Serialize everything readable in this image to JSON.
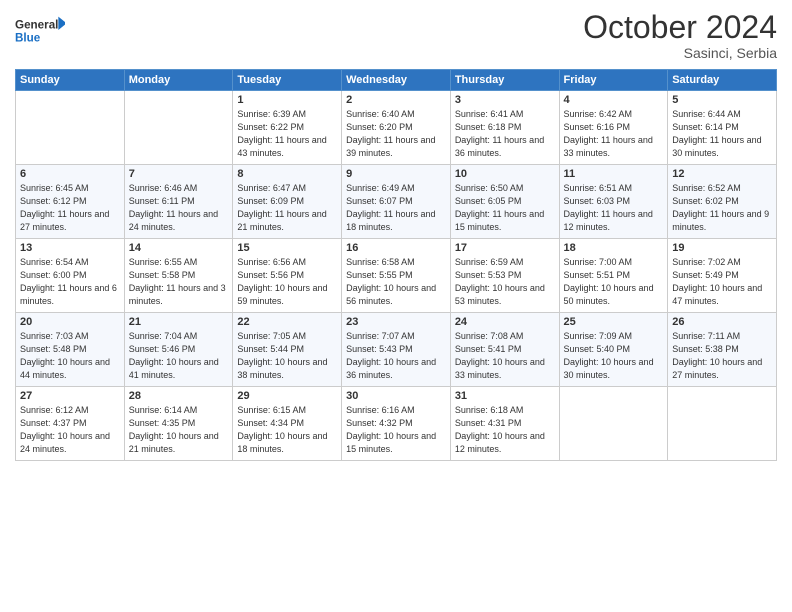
{
  "logo": {
    "line1": "General",
    "line2": "Blue"
  },
  "title": "October 2024",
  "subtitle": "Sasinci, Serbia",
  "days_header": [
    "Sunday",
    "Monday",
    "Tuesday",
    "Wednesday",
    "Thursday",
    "Friday",
    "Saturday"
  ],
  "weeks": [
    [
      {
        "day": "",
        "sunrise": "",
        "sunset": "",
        "daylight": ""
      },
      {
        "day": "",
        "sunrise": "",
        "sunset": "",
        "daylight": ""
      },
      {
        "day": "1",
        "sunrise": "Sunrise: 6:39 AM",
        "sunset": "Sunset: 6:22 PM",
        "daylight": "Daylight: 11 hours and 43 minutes."
      },
      {
        "day": "2",
        "sunrise": "Sunrise: 6:40 AM",
        "sunset": "Sunset: 6:20 PM",
        "daylight": "Daylight: 11 hours and 39 minutes."
      },
      {
        "day": "3",
        "sunrise": "Sunrise: 6:41 AM",
        "sunset": "Sunset: 6:18 PM",
        "daylight": "Daylight: 11 hours and 36 minutes."
      },
      {
        "day": "4",
        "sunrise": "Sunrise: 6:42 AM",
        "sunset": "Sunset: 6:16 PM",
        "daylight": "Daylight: 11 hours and 33 minutes."
      },
      {
        "day": "5",
        "sunrise": "Sunrise: 6:44 AM",
        "sunset": "Sunset: 6:14 PM",
        "daylight": "Daylight: 11 hours and 30 minutes."
      }
    ],
    [
      {
        "day": "6",
        "sunrise": "Sunrise: 6:45 AM",
        "sunset": "Sunset: 6:12 PM",
        "daylight": "Daylight: 11 hours and 27 minutes."
      },
      {
        "day": "7",
        "sunrise": "Sunrise: 6:46 AM",
        "sunset": "Sunset: 6:11 PM",
        "daylight": "Daylight: 11 hours and 24 minutes."
      },
      {
        "day": "8",
        "sunrise": "Sunrise: 6:47 AM",
        "sunset": "Sunset: 6:09 PM",
        "daylight": "Daylight: 11 hours and 21 minutes."
      },
      {
        "day": "9",
        "sunrise": "Sunrise: 6:49 AM",
        "sunset": "Sunset: 6:07 PM",
        "daylight": "Daylight: 11 hours and 18 minutes."
      },
      {
        "day": "10",
        "sunrise": "Sunrise: 6:50 AM",
        "sunset": "Sunset: 6:05 PM",
        "daylight": "Daylight: 11 hours and 15 minutes."
      },
      {
        "day": "11",
        "sunrise": "Sunrise: 6:51 AM",
        "sunset": "Sunset: 6:03 PM",
        "daylight": "Daylight: 11 hours and 12 minutes."
      },
      {
        "day": "12",
        "sunrise": "Sunrise: 6:52 AM",
        "sunset": "Sunset: 6:02 PM",
        "daylight": "Daylight: 11 hours and 9 minutes."
      }
    ],
    [
      {
        "day": "13",
        "sunrise": "Sunrise: 6:54 AM",
        "sunset": "Sunset: 6:00 PM",
        "daylight": "Daylight: 11 hours and 6 minutes."
      },
      {
        "day": "14",
        "sunrise": "Sunrise: 6:55 AM",
        "sunset": "Sunset: 5:58 PM",
        "daylight": "Daylight: 11 hours and 3 minutes."
      },
      {
        "day": "15",
        "sunrise": "Sunrise: 6:56 AM",
        "sunset": "Sunset: 5:56 PM",
        "daylight": "Daylight: 10 hours and 59 minutes."
      },
      {
        "day": "16",
        "sunrise": "Sunrise: 6:58 AM",
        "sunset": "Sunset: 5:55 PM",
        "daylight": "Daylight: 10 hours and 56 minutes."
      },
      {
        "day": "17",
        "sunrise": "Sunrise: 6:59 AM",
        "sunset": "Sunset: 5:53 PM",
        "daylight": "Daylight: 10 hours and 53 minutes."
      },
      {
        "day": "18",
        "sunrise": "Sunrise: 7:00 AM",
        "sunset": "Sunset: 5:51 PM",
        "daylight": "Daylight: 10 hours and 50 minutes."
      },
      {
        "day": "19",
        "sunrise": "Sunrise: 7:02 AM",
        "sunset": "Sunset: 5:49 PM",
        "daylight": "Daylight: 10 hours and 47 minutes."
      }
    ],
    [
      {
        "day": "20",
        "sunrise": "Sunrise: 7:03 AM",
        "sunset": "Sunset: 5:48 PM",
        "daylight": "Daylight: 10 hours and 44 minutes."
      },
      {
        "day": "21",
        "sunrise": "Sunrise: 7:04 AM",
        "sunset": "Sunset: 5:46 PM",
        "daylight": "Daylight: 10 hours and 41 minutes."
      },
      {
        "day": "22",
        "sunrise": "Sunrise: 7:05 AM",
        "sunset": "Sunset: 5:44 PM",
        "daylight": "Daylight: 10 hours and 38 minutes."
      },
      {
        "day": "23",
        "sunrise": "Sunrise: 7:07 AM",
        "sunset": "Sunset: 5:43 PM",
        "daylight": "Daylight: 10 hours and 36 minutes."
      },
      {
        "day": "24",
        "sunrise": "Sunrise: 7:08 AM",
        "sunset": "Sunset: 5:41 PM",
        "daylight": "Daylight: 10 hours and 33 minutes."
      },
      {
        "day": "25",
        "sunrise": "Sunrise: 7:09 AM",
        "sunset": "Sunset: 5:40 PM",
        "daylight": "Daylight: 10 hours and 30 minutes."
      },
      {
        "day": "26",
        "sunrise": "Sunrise: 7:11 AM",
        "sunset": "Sunset: 5:38 PM",
        "daylight": "Daylight: 10 hours and 27 minutes."
      }
    ],
    [
      {
        "day": "27",
        "sunrise": "Sunrise: 6:12 AM",
        "sunset": "Sunset: 4:37 PM",
        "daylight": "Daylight: 10 hours and 24 minutes."
      },
      {
        "day": "28",
        "sunrise": "Sunrise: 6:14 AM",
        "sunset": "Sunset: 4:35 PM",
        "daylight": "Daylight: 10 hours and 21 minutes."
      },
      {
        "day": "29",
        "sunrise": "Sunrise: 6:15 AM",
        "sunset": "Sunset: 4:34 PM",
        "daylight": "Daylight: 10 hours and 18 minutes."
      },
      {
        "day": "30",
        "sunrise": "Sunrise: 6:16 AM",
        "sunset": "Sunset: 4:32 PM",
        "daylight": "Daylight: 10 hours and 15 minutes."
      },
      {
        "day": "31",
        "sunrise": "Sunrise: 6:18 AM",
        "sunset": "Sunset: 4:31 PM",
        "daylight": "Daylight: 10 hours and 12 minutes."
      },
      {
        "day": "",
        "sunrise": "",
        "sunset": "",
        "daylight": ""
      },
      {
        "day": "",
        "sunrise": "",
        "sunset": "",
        "daylight": ""
      }
    ]
  ]
}
